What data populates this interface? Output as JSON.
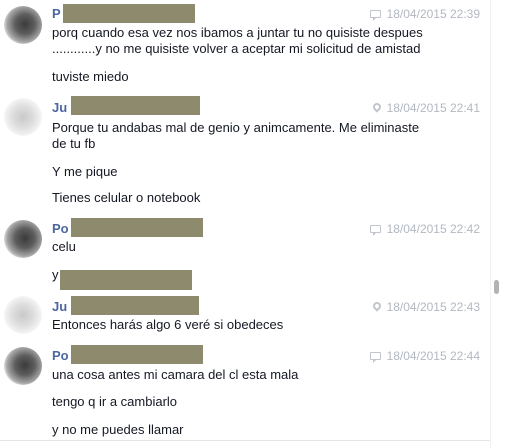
{
  "conversation": {
    "messages": [
      {
        "sender": "P",
        "avatar_tone": "dark",
        "meta_icon": "chat-icon",
        "timestamp": "18/04/2015 22:39",
        "lines": [
          "porq cuando esa vez nos ibamos a juntar tu no quisiste despues",
          "............y no me quisiste volver a aceptar mi solicitud de amistad",
          "tuviste miedo"
        ]
      },
      {
        "sender": "Ju",
        "avatar_tone": "light",
        "meta_icon": "location-pin-icon",
        "timestamp": "18/04/2015 22:41",
        "lines": [
          "Porque  tu andabas mal de genio y animcamente. Me eliminaste",
          "de tu fb",
          "Y me pique",
          "Tienes celular o notebook"
        ]
      },
      {
        "sender": "Po",
        "avatar_tone": "dark",
        "meta_icon": "chat-icon",
        "timestamp": "18/04/2015 22:42",
        "lines": [
          "celu",
          "y"
        ]
      },
      {
        "sender": "Ju",
        "avatar_tone": "light",
        "meta_icon": "location-pin-icon",
        "timestamp": "18/04/2015 22:43",
        "lines": [
          "Entonces harás algo 6 veré si obedeces"
        ]
      },
      {
        "sender": "Po",
        "avatar_tone": "dark",
        "meta_icon": "chat-icon",
        "timestamp": "18/04/2015 22:44",
        "lines": [
          "una cosa antes mi camara del cl esta mala",
          "tengo q ir a cambiarlo",
          "y no me puedes llamar"
        ]
      }
    ]
  },
  "colors": {
    "sender_name": "#4b67a1",
    "timestamp": "#b3b8c1",
    "redaction": "#8e8a6e",
    "message_text": "#141823"
  }
}
